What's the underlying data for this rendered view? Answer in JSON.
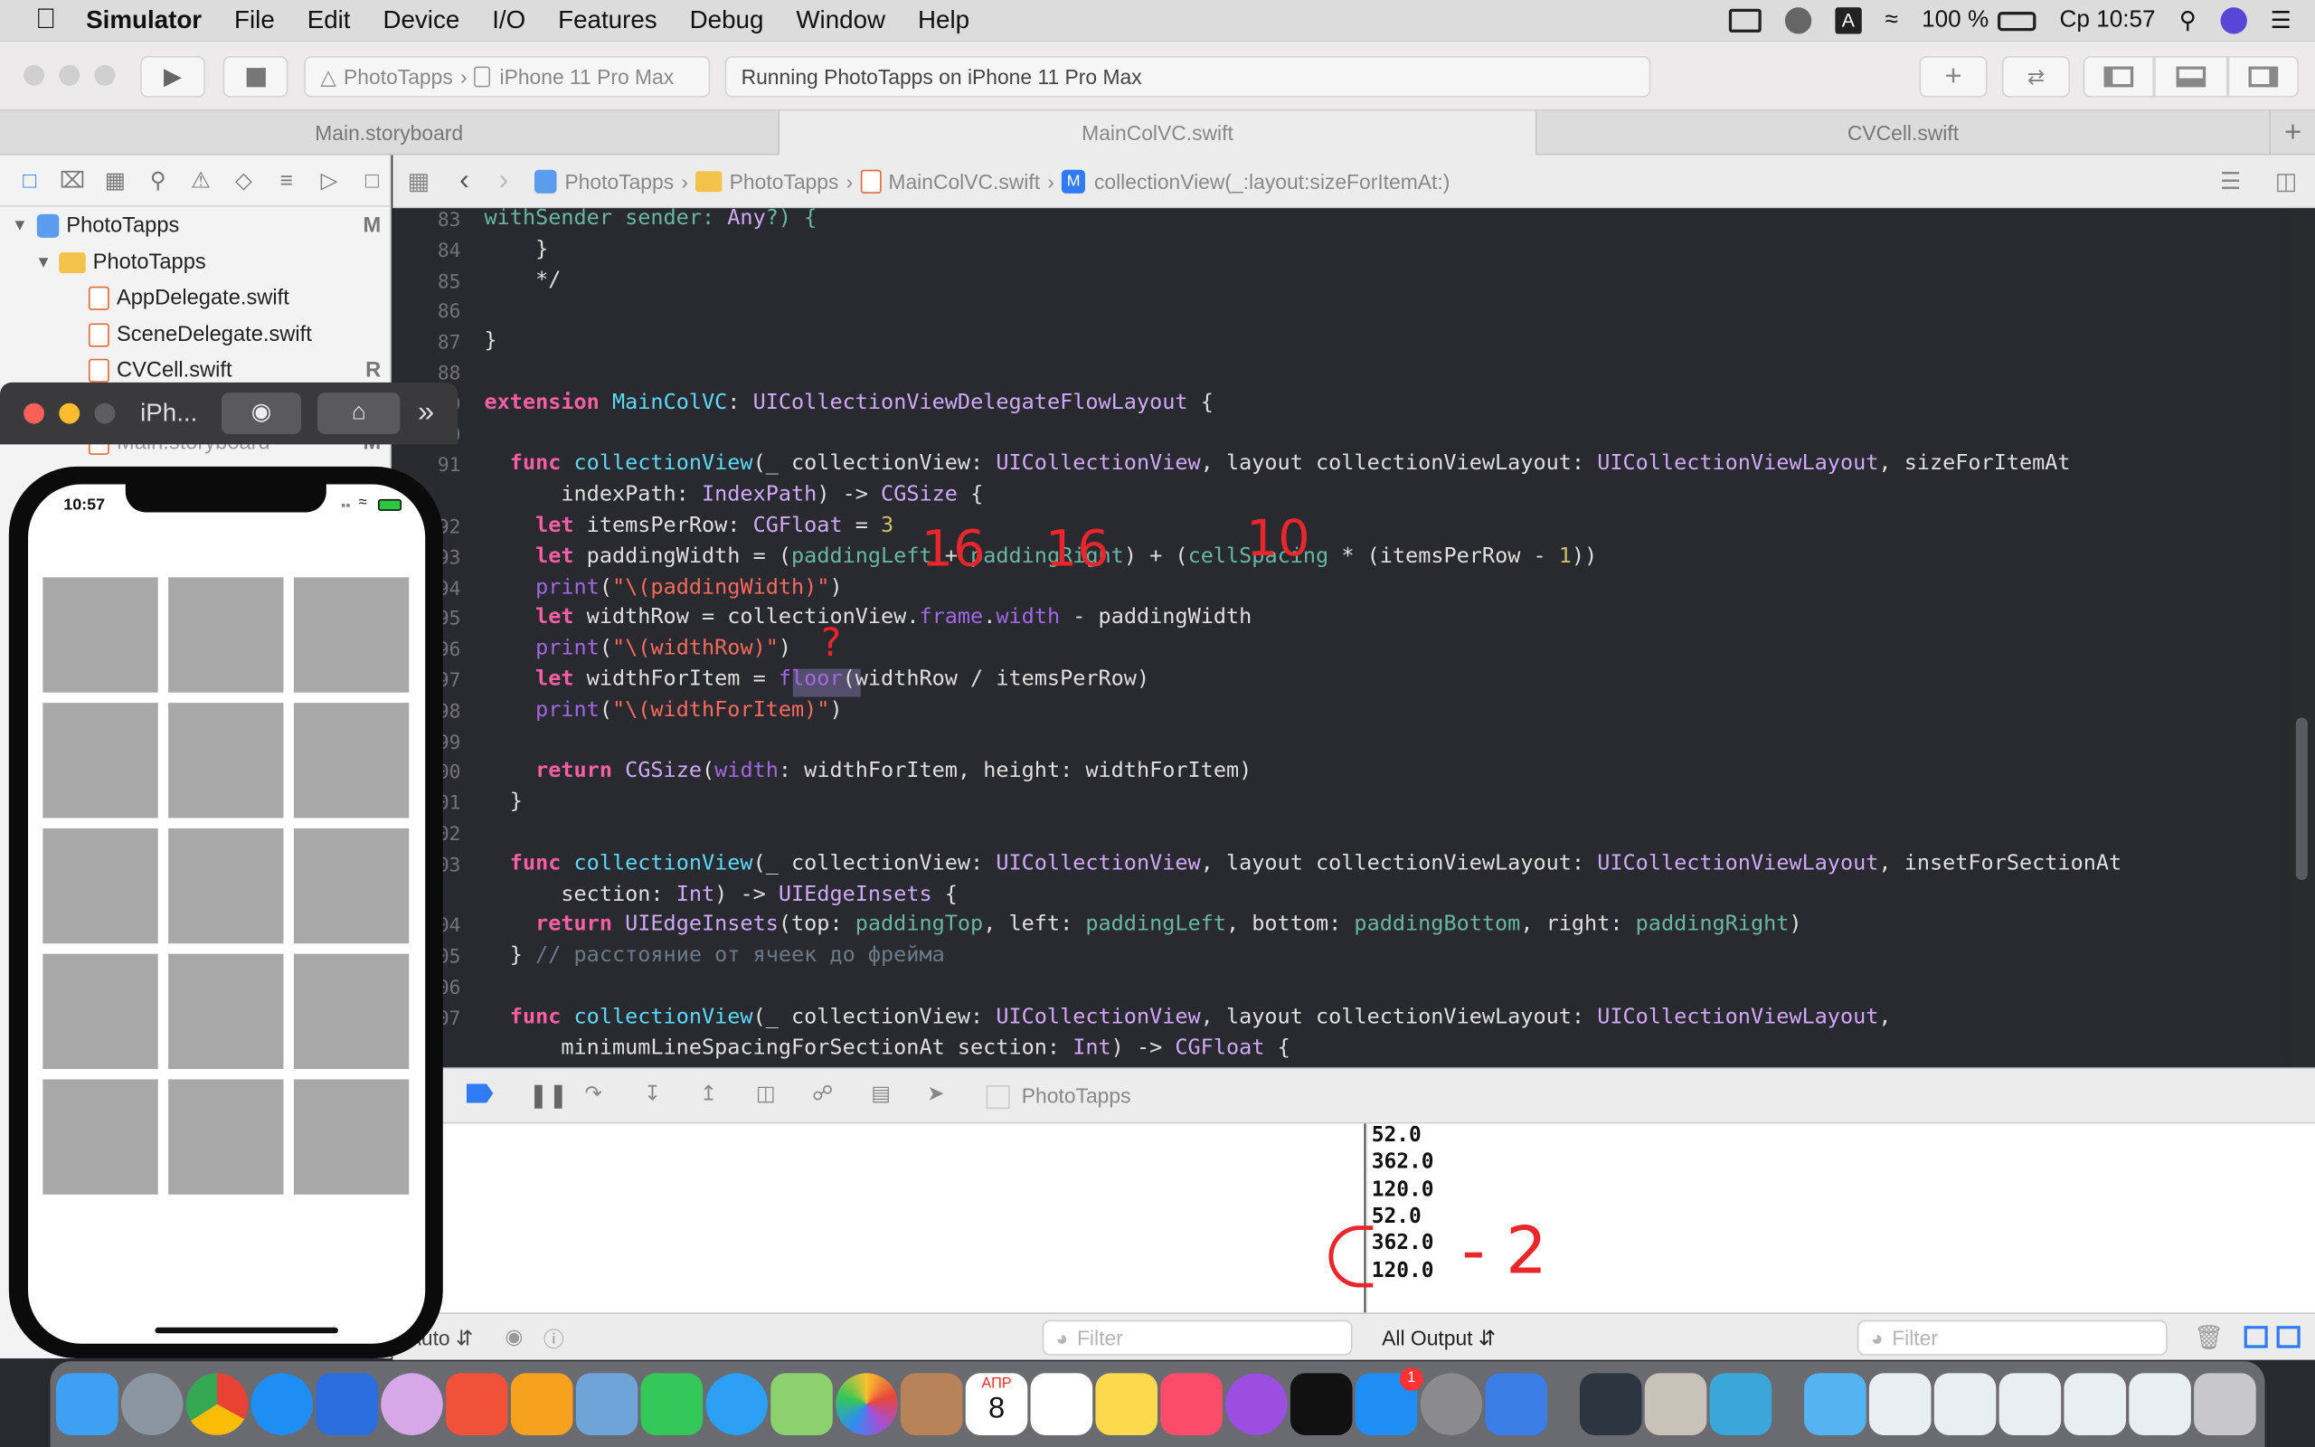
{
  "menubar": {
    "apple": "",
    "app_name": "Simulator",
    "items": [
      "File",
      "Edit",
      "Device",
      "I/O",
      "Features",
      "Debug",
      "Window",
      "Help"
    ],
    "battery": "100 %",
    "clock": "Ср 10:57"
  },
  "toolbar": {
    "scheme_project": "PhotoTapps",
    "scheme_device": "iPhone 11 Pro Max",
    "status": "Running PhotoTapps on iPhone 11 Pro Max"
  },
  "tabs": [
    "Main.storyboard",
    "MainColVC.swift",
    "CVCell.swift"
  ],
  "active_tab_index": 1,
  "navigator": {
    "project": "PhotoTapps",
    "project_badge": "M",
    "group": "PhotoTapps",
    "files": [
      {
        "name": "AppDelegate.swift",
        "badge": ""
      },
      {
        "name": "SceneDelegate.swift",
        "badge": ""
      },
      {
        "name": "CVCell.swift",
        "badge": "R"
      },
      {
        "name": "Main.storyboard",
        "badge": "M"
      }
    ]
  },
  "jumpbar": {
    "crumbs": [
      "PhotoTapps",
      "PhotoTapps",
      "MainColVC.swift",
      "collectionView(_:layout:sizeForItemAt:)"
    ]
  },
  "code_lines": [
    {
      "n": "83",
      "t": "withSender sender: Any?) {"
    },
    {
      "n": "84",
      "t": "    }"
    },
    {
      "n": "85",
      "t": "    */"
    },
    {
      "n": "86",
      "t": ""
    },
    {
      "n": "87",
      "t": "}"
    },
    {
      "n": "88",
      "t": ""
    },
    {
      "n": "89",
      "t": "extension MainColVC: UICollectionViewDelegateFlowLayout {"
    },
    {
      "n": "90",
      "t": ""
    },
    {
      "n": "91",
      "t": "  func collectionView(_ collectionView: UICollectionView, layout collectionViewLayout: UICollectionViewLayout, sizeForItemAt"
    },
    {
      "n": "",
      "t": "      indexPath: IndexPath) -> CGSize {"
    },
    {
      "n": "92",
      "t": "    let itemsPerRow: CGFloat = 3"
    },
    {
      "n": "93",
      "t": "    let paddingWidth = (paddingLeft + paddingRight) + (cellSpacing * (itemsPerRow - 1))"
    },
    {
      "n": "94",
      "t": "    print(\"\\(paddingWidth)\")"
    },
    {
      "n": "95",
      "t": "    let widthRow = collectionView.frame.width - paddingWidth"
    },
    {
      "n": "96",
      "t": "    print(\"\\(widthRow)\")"
    },
    {
      "n": "97",
      "t": "    let widthForItem = floor(widthRow / itemsPerRow)"
    },
    {
      "n": "98",
      "t": "    print(\"\\(widthForItem)\")"
    },
    {
      "n": "99",
      "t": ""
    },
    {
      "n": "100",
      "t": "    return CGSize(width: widthForItem, height: widthForItem)"
    },
    {
      "n": "101",
      "t": "  }"
    },
    {
      "n": "102",
      "t": ""
    },
    {
      "n": "103",
      "t": "  func collectionView(_ collectionView: UICollectionView, layout collectionViewLayout: UICollectionViewLayout, insetForSectionAt"
    },
    {
      "n": "",
      "t": "      section: Int) -> UIEdgeInsets {"
    },
    {
      "n": "104",
      "t": "    return UIEdgeInsets(top: paddingTop, left: paddingLeft, bottom: paddingBottom, right: paddingRight)"
    },
    {
      "n": "105",
      "t": "  } // расстояние от ячеек до фрейма"
    },
    {
      "n": "106",
      "t": ""
    },
    {
      "n": "107",
      "t": "  func collectionView(_ collectionView: UICollectionView, layout collectionViewLayout: UICollectionViewLayout,"
    },
    {
      "n": "",
      "t": "      minimumLineSpacingForSectionAt section: Int) -> CGFloat {"
    }
  ],
  "debug": {
    "target": "PhotoTapps",
    "auto_label": "Auto",
    "filter_placeholder": "Filter",
    "output_selector": "All Output",
    "console_lines": [
      "52.0",
      "362.0",
      "120.0",
      "52.0",
      "362.0",
      "120.0"
    ]
  },
  "simulator": {
    "window_title": "iPh...",
    "status_time": "10:57",
    "grid_rows": 5,
    "grid_cols": 3
  },
  "annotations": {
    "left_padding": "16",
    "right_padding": "16",
    "spacing": "10",
    "floor_mark": "?",
    "result_note": "- 2"
  },
  "dock": {
    "calendar_month": "АПР",
    "calendar_day": "8",
    "appstore_badge": "1"
  }
}
